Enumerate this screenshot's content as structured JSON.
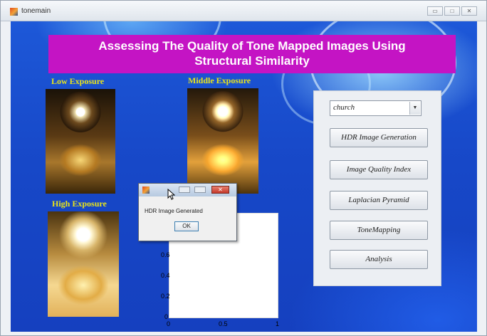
{
  "window": {
    "title": "tonemain",
    "controls": {
      "minimize": "▭",
      "maximize": "□",
      "close": "✕"
    }
  },
  "banner": {
    "line1": "Assessing The Quality of Tone Mapped Images Using",
    "line2": "Structural Similarity"
  },
  "images": {
    "low_label": "Low Exposure",
    "middle_label": "Middle Exposure",
    "high_label": "High Exposure"
  },
  "panel": {
    "dropdown_value": "church",
    "buttons": [
      "HDR Image Generation",
      "Image Quality Index",
      "Laplacian Pyramid",
      "ToneMapping",
      "Analysis"
    ]
  },
  "plot": {
    "y_ticks": [
      "0.6",
      "0.4",
      "0.2",
      "0"
    ],
    "x_ticks": [
      "0",
      "0.5",
      "1"
    ]
  },
  "dialog": {
    "message": "HDR Image Generated",
    "ok_label": "OK"
  },
  "colors": {
    "banner": "#c414c4",
    "label_yellow": "#e8e31a",
    "background_blue": "#1748c8"
  }
}
